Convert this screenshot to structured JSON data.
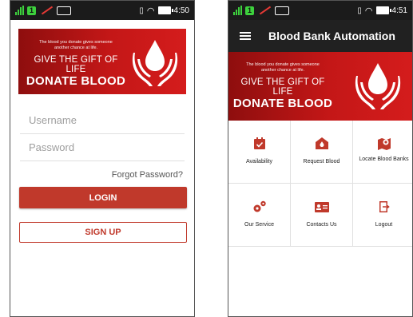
{
  "colors": {
    "brand_red": "#c0392b",
    "status_bar": "#1b1b1b",
    "app_bar": "#212121",
    "signal_green": "#3dd13d"
  },
  "login_screen": {
    "statusbar": {
      "sim_label": "1",
      "time": "4:50"
    },
    "banner": {
      "tagline_line1": "The blood you donate gives someone",
      "tagline_line2": "another chance at life.",
      "give_line": "GIVE THE GIFT OF LIFE",
      "donate_line": "DONATE BLOOD"
    },
    "username_placeholder": "Username",
    "password_placeholder": "Password",
    "forgot_password": "Forgot Password?",
    "login_label": "LOGIN",
    "signup_label": "SIGN UP"
  },
  "dashboard_screen": {
    "statusbar": {
      "sim_label": "1",
      "time": "4:51"
    },
    "app_title": "Blood Bank Automation",
    "banner": {
      "tagline_line1": "The blood you donate gives someone",
      "tagline_line2": "another chance at life.",
      "give_line": "GIVE THE GIFT OF LIFE",
      "donate_line": "DONATE BLOOD"
    },
    "menu": [
      {
        "label": "Availability",
        "icon": "calendar-check-icon"
      },
      {
        "label": "Request Blood",
        "icon": "envelope-icon"
      },
      {
        "label": "Locate Blood Banks",
        "icon": "map-pin-icon"
      },
      {
        "label": "Our Service",
        "icon": "gears-icon"
      },
      {
        "label": "Contacts Us",
        "icon": "contact-card-icon"
      },
      {
        "label": "Logout",
        "icon": "logout-icon"
      }
    ]
  }
}
